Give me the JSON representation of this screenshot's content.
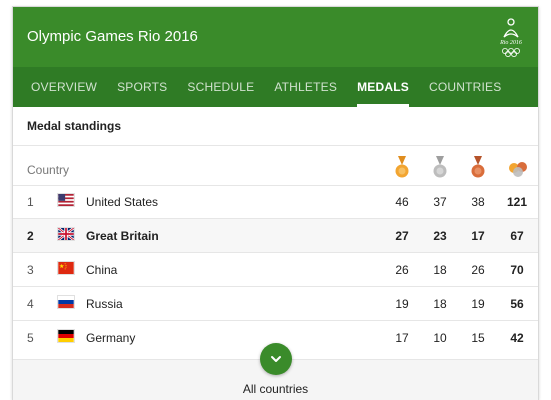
{
  "header": {
    "title": "Olympic Games Rio 2016",
    "logo_text": "Rio 2016",
    "color": "#3a8b2a"
  },
  "tabs": [
    {
      "label": "OVERVIEW",
      "active": false
    },
    {
      "label": "SPORTS",
      "active": false
    },
    {
      "label": "SCHEDULE",
      "active": false
    },
    {
      "label": "ATHLETES",
      "active": false
    },
    {
      "label": "MEDALS",
      "active": true
    },
    {
      "label": "COUNTRIES",
      "active": false
    }
  ],
  "standings": {
    "title": "Medal standings",
    "column_country": "Country",
    "medal_icons": [
      "gold-medal-icon",
      "silver-medal-icon",
      "bronze-medal-icon",
      "total-medals-icon"
    ],
    "medal_colors": {
      "gold": "#f2a531",
      "silver": "#bdbdbd",
      "bronze": "#d96d3b"
    },
    "rows": [
      {
        "rank": "1",
        "flag": "us-flag-icon",
        "country": "United States",
        "gold": "46",
        "silver": "37",
        "bronze": "38",
        "total": "121"
      },
      {
        "rank": "2",
        "flag": "gb-flag-icon",
        "country": "Great Britain",
        "gold": "27",
        "silver": "23",
        "bronze": "17",
        "total": "67",
        "highlighted": true
      },
      {
        "rank": "3",
        "flag": "cn-flag-icon",
        "country": "China",
        "gold": "26",
        "silver": "18",
        "bronze": "26",
        "total": "70"
      },
      {
        "rank": "4",
        "flag": "ru-flag-icon",
        "country": "Russia",
        "gold": "19",
        "silver": "18",
        "bronze": "19",
        "total": "56"
      },
      {
        "rank": "5",
        "flag": "de-flag-icon",
        "country": "Germany",
        "gold": "17",
        "silver": "10",
        "bronze": "15",
        "total": "42"
      }
    ]
  },
  "footer": {
    "label": "All countries",
    "icon": "chevron-down-icon"
  }
}
